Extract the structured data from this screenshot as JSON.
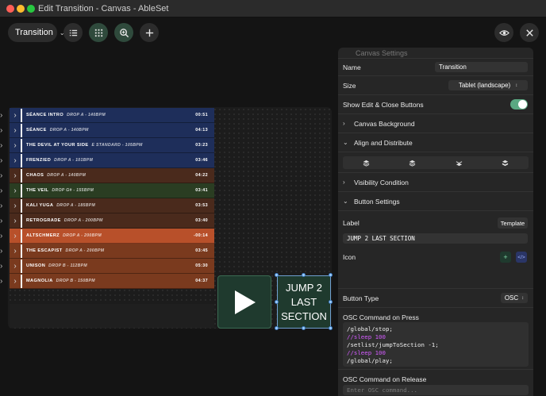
{
  "window": {
    "title": "Edit Transition - Canvas - AbleSet"
  },
  "toolbar": {
    "canvas_select": "Transition",
    "icons": [
      "list-icon",
      "grid-icon",
      "zoom-icon",
      "plus-icon",
      "eye-icon",
      "close-icon"
    ]
  },
  "setlist": [
    {
      "name": "SÉANCE INTRO",
      "sub": "DROP A - 140BPM",
      "dur": "00:51",
      "color": "#1e2e5a"
    },
    {
      "name": "SÉANCE",
      "sub": "DROP A - 140BPM",
      "dur": "04:13",
      "color": "#1e2e5a"
    },
    {
      "name": "THE DEVIL AT YOUR SIDE",
      "sub": "E STANDARD - 105BPM",
      "dur": "03:23",
      "color": "#1e2e5a"
    },
    {
      "name": "FRENZIED",
      "sub": "DROP A - 101BPM",
      "dur": "03:46",
      "color": "#1e2e5a"
    },
    {
      "name": "CHAOS",
      "sub": "DROP A - 140BPM",
      "dur": "04:22",
      "color": "#4a2a1c"
    },
    {
      "name": "THE VEIL",
      "sub": "DROP G# - 155BPM",
      "dur": "03:41",
      "color": "#2a3d22"
    },
    {
      "name": "KALI YUGA",
      "sub": "DROP A - 185BPM",
      "dur": "03:53",
      "color": "#4a2a1c"
    },
    {
      "name": "RETROGRADE",
      "sub": "DROP A - 200BPM",
      "dur": "03:40",
      "color": "#4a2a1c"
    },
    {
      "name": "ALTSCHMERZ",
      "sub": "DROP A - 200BPM",
      "dur": "-00:14",
      "color": "#b8502a"
    },
    {
      "name": "THE ESCAPIST",
      "sub": "DROP A - 200BPM",
      "dur": "03:45",
      "color": "#7a3a1e"
    },
    {
      "name": "UNISON",
      "sub": "DROP B - 112BPM",
      "dur": "05:30",
      "color": "#7a3a1e"
    },
    {
      "name": "MAGNOLIA",
      "sub": "DROP B - 150BPM",
      "dur": "04:37",
      "color": "#7a3a1e"
    }
  ],
  "canvas_buttons": {
    "play_icon": "play-icon",
    "jump_line1": "JUMP 2",
    "jump_line2": "LAST",
    "jump_line3": "SECTION"
  },
  "panel": {
    "header": "Canvas Settings",
    "name_label": "Name",
    "name_value": "Transition",
    "size_label": "Size",
    "size_value": "Tablet (landscape)",
    "show_buttons_label": "Show Edit & Close Buttons",
    "show_buttons_on": true,
    "canvas_background": "Canvas Background",
    "align_distribute": "Align and Distribute",
    "visibility_condition": "Visibility Condition",
    "button_settings": "Button Settings",
    "label_label": "Label",
    "template_btn": "Template",
    "label_value": "JUMP 2 LAST SECTION",
    "icon_label": "Icon",
    "button_type_label": "Button Type",
    "button_type_value": "OSC",
    "osc_press_label": "OSC Command on Press",
    "osc_press_lines": [
      {
        "text": "/global/stop;",
        "comment": false
      },
      {
        "text": "//sleep 100",
        "comment": true
      },
      {
        "text": "/setlist/jumpToSection -1;",
        "comment": false
      },
      {
        "text": "//sleep 100",
        "comment": true
      },
      {
        "text": "/global/play;",
        "comment": false
      }
    ],
    "osc_release_label": "OSC Command on Release",
    "osc_release_placeholder": "Enter OSC command..."
  },
  "colors": {
    "accent": "#5aa882",
    "button_bg": "#1f3a2e",
    "selection": "#6fa0d0"
  }
}
